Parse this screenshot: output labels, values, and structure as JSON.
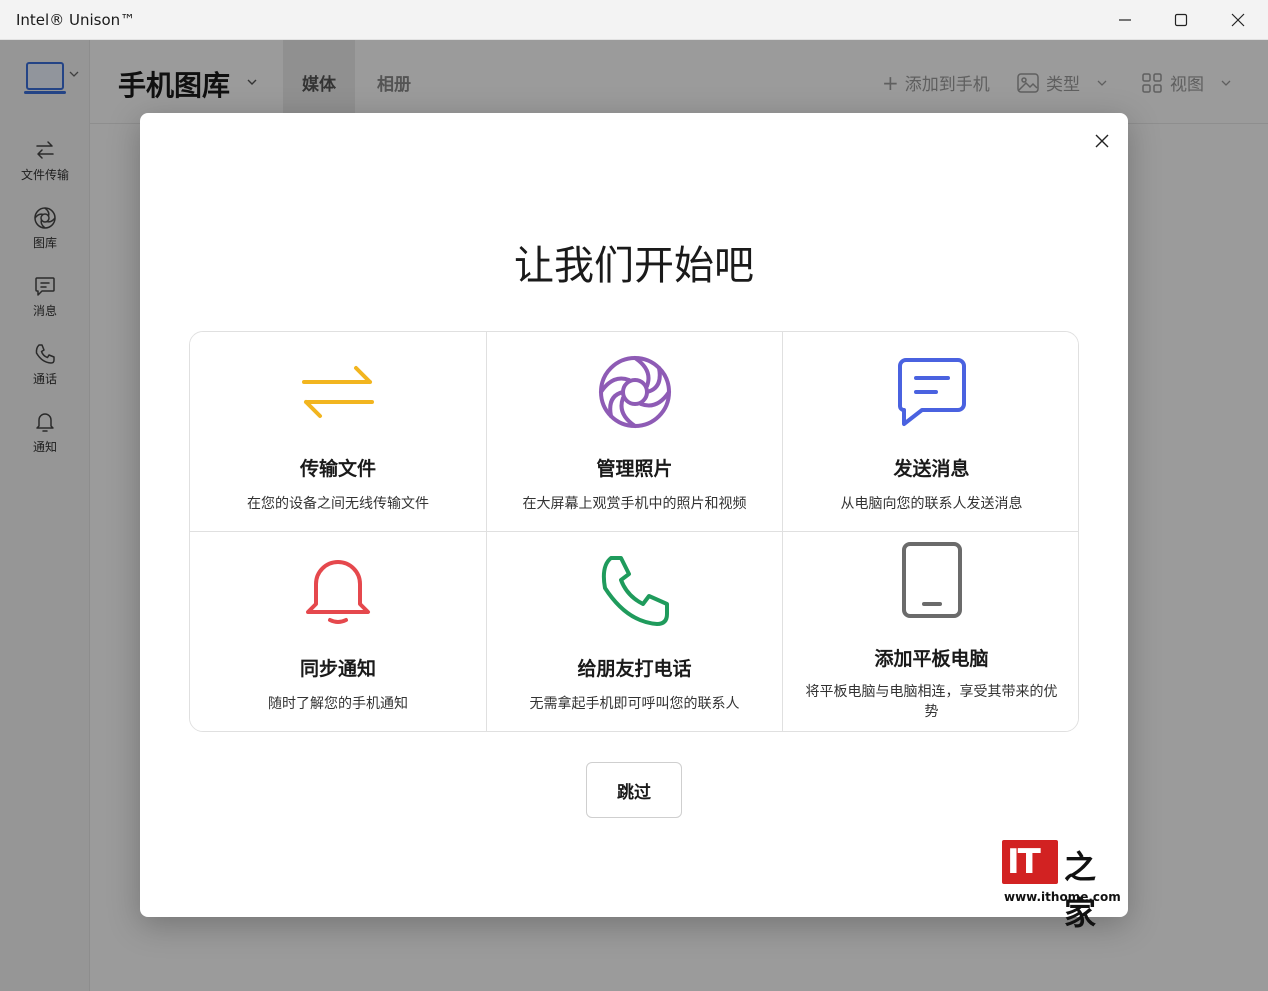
{
  "window": {
    "title": "Intel® Unison™"
  },
  "sidebar": {
    "items": [
      {
        "label": "文件传输",
        "icon": "transfer-icon"
      },
      {
        "label": "图库",
        "icon": "gallery-icon"
      },
      {
        "label": "消息",
        "icon": "message-icon"
      },
      {
        "label": "通话",
        "icon": "phone-icon"
      },
      {
        "label": "通知",
        "icon": "bell-icon"
      }
    ]
  },
  "header": {
    "title": "手机图库",
    "tabs": [
      {
        "label": "媒体",
        "active": true
      },
      {
        "label": "相册",
        "active": false
      }
    ],
    "tools": {
      "add": "添加到手机",
      "type": "类型",
      "view": "视图"
    }
  },
  "dialog": {
    "title": "让我们开始吧",
    "cards": [
      {
        "title": "传输文件",
        "desc": "在您的设备之间无线传输文件",
        "icon": "transfer-arrows-icon",
        "color": "#f2b51f"
      },
      {
        "title": "管理照片",
        "desc": "在大屏幕上观赏手机中的照片和视频",
        "icon": "aperture-icon",
        "color": "#8e5bb5"
      },
      {
        "title": "发送消息",
        "desc": "从电脑向您的联系人发送消息",
        "icon": "chat-icon",
        "color": "#4a62e0"
      },
      {
        "title": "同步通知",
        "desc": "随时了解您的手机通知",
        "icon": "bell-icon",
        "color": "#e5484d"
      },
      {
        "title": "给朋友打电话",
        "desc": "无需拿起手机即可呼叫您的联系人",
        "icon": "phone-icon",
        "color": "#1f9b5c"
      },
      {
        "title": "添加平板电脑",
        "desc": "将平板电脑与电脑相连，享受其带来的优势",
        "icon": "tablet-icon",
        "color": "#6b6b6b"
      }
    ],
    "skip_label": "跳过"
  },
  "watermark": {
    "logo_text": "IT之家",
    "url": "www.ithome.com"
  }
}
